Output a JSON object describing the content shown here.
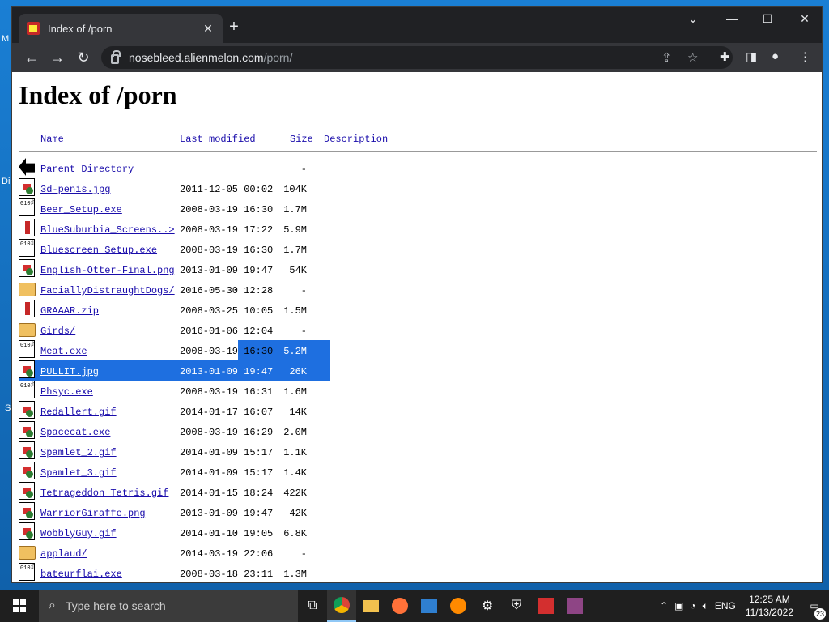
{
  "browser": {
    "tab_title": "Index of /porn",
    "url_host": "nosebleed.alienmelon.com",
    "url_path": "/porn/"
  },
  "page": {
    "heading": "Index of /porn",
    "columns": [
      "Name",
      "Last modified",
      "Size",
      "Description"
    ],
    "rows": [
      {
        "icon": "back",
        "name": "Parent Directory",
        "date": "",
        "size": "-"
      },
      {
        "icon": "img",
        "name": "3d-penis.jpg",
        "date": "2011-12-05 00:02",
        "size": "104K"
      },
      {
        "icon": "bin",
        "name": "Beer_Setup.exe",
        "date": "2008-03-19 16:30",
        "size": "1.7M"
      },
      {
        "icon": "zip",
        "name": "BlueSuburbia_Screens..>",
        "date": "2008-03-19 17:22",
        "size": "5.9M"
      },
      {
        "icon": "bin",
        "name": "Bluescreen_Setup.exe",
        "date": "2008-03-19 16:30",
        "size": "1.7M"
      },
      {
        "icon": "img",
        "name": "English-Otter-Final.png",
        "date": "2013-01-09 19:47",
        "size": "54K"
      },
      {
        "icon": "dir",
        "name": "FaciallyDistraughtDogs/",
        "date": "2016-05-30 12:28",
        "size": "-"
      },
      {
        "icon": "zip",
        "name": "GRAAAR.zip",
        "date": "2008-03-25 10:05",
        "size": "1.5M"
      },
      {
        "icon": "dir",
        "name": "Girds/",
        "date": "2016-01-06 12:04",
        "size": "-"
      },
      {
        "icon": "bin",
        "name": "Meat.exe",
        "date": "2008-03-19 16:30",
        "size": "5.2M"
      },
      {
        "icon": "img",
        "name": "PULLIT.jpg",
        "date": "2013-01-09 19:47",
        "size": "26K"
      },
      {
        "icon": "bin",
        "name": "Phsyc.exe",
        "date": "2008-03-19 16:31",
        "size": "1.6M"
      },
      {
        "icon": "img",
        "name": "Redallert.gif",
        "date": "2014-01-17 16:07",
        "size": "14K"
      },
      {
        "icon": "img",
        "name": "Spacecat.exe",
        "date": "2008-03-19 16:29",
        "size": "2.0M"
      },
      {
        "icon": "img",
        "name": "Spamlet_2.gif",
        "date": "2014-01-09 15:17",
        "size": "1.1K"
      },
      {
        "icon": "img",
        "name": "Spamlet_3.gif",
        "date": "2014-01-09 15:17",
        "size": "1.4K"
      },
      {
        "icon": "img",
        "name": "Tetrageddon_Tetris.gif",
        "date": "2014-01-15 18:24",
        "size": "422K"
      },
      {
        "icon": "img",
        "name": "WarriorGiraffe.png",
        "date": "2013-01-09 19:47",
        "size": "42K"
      },
      {
        "icon": "img",
        "name": "WobblyGuy.gif",
        "date": "2014-01-10 19:05",
        "size": "6.8K"
      },
      {
        "icon": "dir",
        "name": "applaud/",
        "date": "2014-03-19 22:06",
        "size": "-"
      },
      {
        "icon": "bin",
        "name": "bateurflai.exe",
        "date": "2008-03-18 23:11",
        "size": "1.3M"
      }
    ]
  },
  "taskbar": {
    "search_placeholder": "Type here to search",
    "language": "ENG",
    "time": "12:25 AM",
    "date": "11/13/2022",
    "notification_count": "23"
  }
}
